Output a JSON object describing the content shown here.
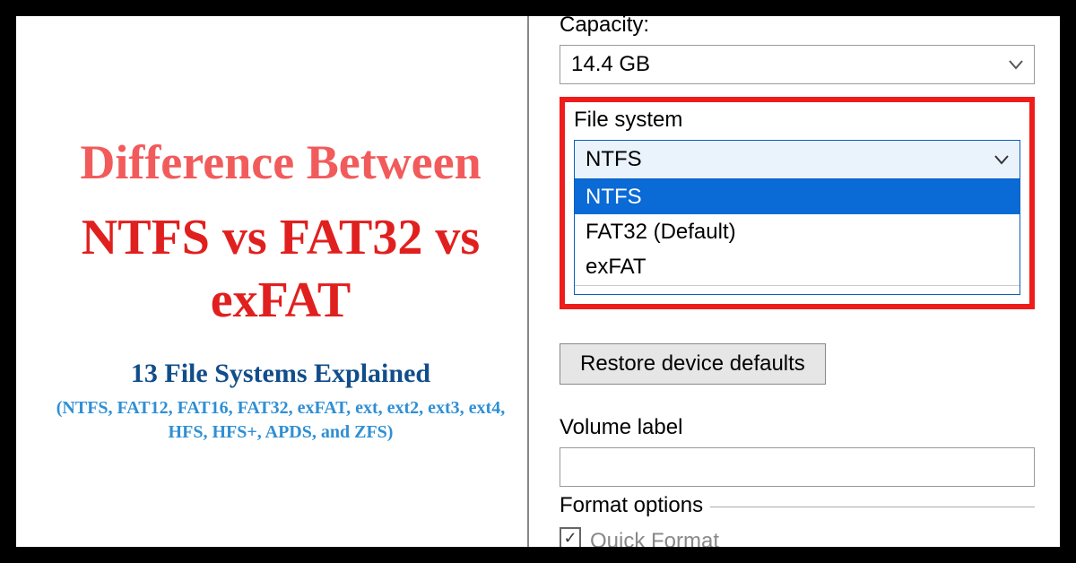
{
  "left": {
    "headline1": "Difference Between",
    "headline2": "NTFS vs FAT32 vs exFAT",
    "sub1": "13 File Systems Explained",
    "sub2": "(NTFS, FAT12, FAT16, FAT32, exFAT, ext, ext2, ext3, ext4, HFS, HFS+, APDS, and ZFS)"
  },
  "dialog": {
    "capacity_label": "Capacity:",
    "capacity_value": "14.4 GB",
    "filesystem_label": "File system",
    "filesystem_value": "NTFS",
    "filesystem_options": {
      "opt0": "NTFS",
      "opt1": "FAT32 (Default)",
      "opt2": "exFAT"
    },
    "restore_label": "Restore device defaults",
    "volume_label": "Volume label",
    "volume_value": "",
    "format_options_label": "Format options",
    "quick_format_label": "Quick Format",
    "quick_format_checked": "✓"
  },
  "colors": {
    "red_headline": "#e0201f",
    "salmon_headline": "#f25b5b",
    "blue_dark": "#114d8a",
    "blue_light": "#2f8fd4",
    "highlight_border": "#ef1c1c",
    "win_blue": "#0a6ad6"
  }
}
